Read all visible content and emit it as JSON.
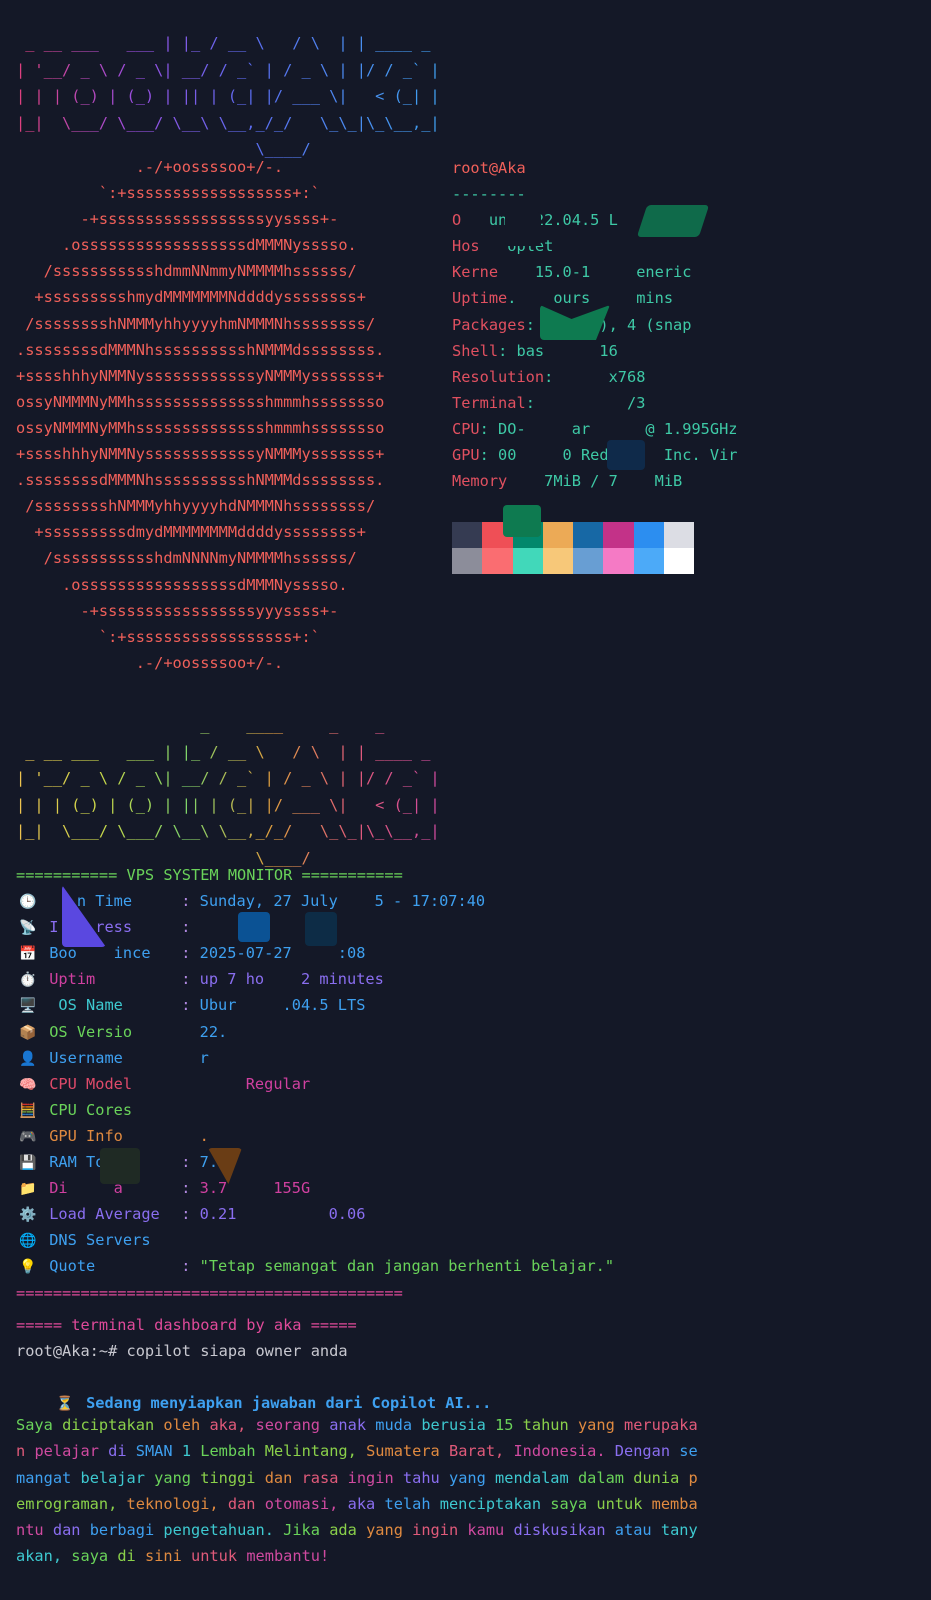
{
  "banner_lines": [
    " _ __ ___   ___ | |_ / __ \\   / \\  | | ____ _",
    "| '__/ _ \\ / _ \\| __/ / _` | / _ \\ | |/ / _` |",
    "| | | (_) | (_) | || | (_| |/ ___ \\|   < (_| |",
    "|_|  \\___/ \\___/ \\__\\ \\__,_/_/   \\_\\_|\\_\\__,_|",
    "                          \\____/"
  ],
  "banner_lines_2": [
    "                    _    ____     _    _",
    " _ __ ___   ___ | |_ / __ \\   / \\  | | ____ _",
    "| '__/ _ \\ / _ \\| __/ / _` | / _ \\ | |/ / _` |",
    "| | | (_) | (_) | || | (_| |/ ___ \\|   < (_| |",
    "|_|  \\___/ \\___/ \\__\\ \\__,_/_/   \\_\\_|\\_\\__,_|",
    "                          \\____/"
  ],
  "ubuntu_logo_lines": [
    "             .-/+oossssoo+/-.",
    "         `:+ssssssssssssssssss+:`",
    "       -+ssssssssssssssssssyyssss+-",
    "     .ossssssssssssssssssdMMMNysssso.",
    "   /ssssssssssshdmmNNmmyNMMMMhssssss/",
    "  +ssssssssshmydMMMMMMMNddddyssssssss+",
    " /sssssssshNMMMyhhyyyyhmNMMMNhssssssss/",
    ".ssssssssdMMMNhsssssssssshNMMMdssssssss.",
    "+sssshhhyNMMNyssssssssssssyNMMMysssssss+",
    "ossyNMMMNyMMhsssssssssssssshmmmhssssssso",
    "ossyNMMMNyMMhsssssssssssssshmmmhssssssso",
    "+sssshhhyNMMNyssssssssssssyNMMMysssssss+",
    ".ssssssssdMMMNhsssssssssshNMMMdssssssss.",
    " /sssssssshNMMMyhhyyyyhdNMMMNhssssssss/",
    "  +sssssssssdmydMMMMMMMMddddyssssssss+",
    "   /ssssssssssshdmNNNNmyNMMMMhssssss/",
    "     .osssssssssssssssssdMMMNysssso.",
    "       -+sssssssssssssssssyyyssss+-",
    "         `:+ssssssssssssssssss+:`",
    "             .-/+oossssoo+/-."
  ],
  "neofetch": {
    "title": "root@Aka",
    "separator": "--------",
    "rows": [
      {
        "key": "O",
        "value": "   untu 22.04.5 L    86_64"
      },
      {
        "key": "Hos",
        "value": "   oplet"
      },
      {
        "key": "Kerne",
        "value": "    15.0-1     eneric"
      },
      {
        "key": "Uptime",
        "value": ".    ours     mins"
      },
      {
        "key": "Packages",
        "value": ":     kg), 4 (snap"
      },
      {
        "key": "Shell",
        "value": ": bas      16"
      },
      {
        "key": "Resolution",
        "value": ":      x768"
      },
      {
        "key": "Terminal",
        "value": ":          /3"
      },
      {
        "key": "CPU",
        "value": ": DO-     ar      @ 1.995GHz"
      },
      {
        "key": "GPU",
        "value": ": 00     0 Red      Inc. Vir"
      },
      {
        "key": "Memory",
        "value": "    7MiB / 7    MiB"
      }
    ],
    "palette_top": [
      "#353b52",
      "#ef4f56",
      "#02886c",
      "#ecaa56",
      "#1768a5",
      "#c33288",
      "#2c8ef0",
      "#dcdde4"
    ],
    "palette_bottom": [
      "#8c8d9a",
      "#fa6d71",
      "#41d8ba",
      "#f7c879",
      "#689ed3",
      "#f57ac5",
      "#4caaf8",
      "#ffffff"
    ]
  },
  "monitor": {
    "title": "=========== VPS SYSTEM MONITOR ===========",
    "rows": [
      {
        "icon": "🕒",
        "label": "   n Time",
        "colon": ": ",
        "value": "Sunday, 27 July    5 - 17:07:40"
      },
      {
        "icon": "📡",
        "label": "I    ress",
        "colon": ": ",
        "value": ""
      },
      {
        "icon": "📅",
        "label": "Boo    ince",
        "colon": ": ",
        "value": "2025-07-27     :08"
      },
      {
        "icon": "⏱️",
        "label": "Uptim",
        "colon": ": ",
        "value": "up 7 ho    2 minutes"
      },
      {
        "icon": "🖥️",
        "label": " OS Name",
        "colon": ": ",
        "value": "Ubur     .04.5 LTS"
      },
      {
        "icon": "📦",
        "label": "OS Versio",
        "colon": "  ",
        "value": "22."
      },
      {
        "icon": "👤",
        "label": "Username",
        "colon": "  ",
        "value": "r"
      },
      {
        "icon": "🧠",
        "label": "CPU Model",
        "colon": "  ",
        "value": "     Regular"
      },
      {
        "icon": "🧮",
        "label": "CPU Cores",
        "colon": "  ",
        "value": ""
      },
      {
        "icon": "🎮",
        "label": "GPU Info",
        "colon": "  ",
        "value": "."
      },
      {
        "icon": "💾",
        "label": "RAM To",
        "colon": ": ",
        "value": "7."
      },
      {
        "icon": "📁",
        "label": "Di     a",
        "colon": ": ",
        "value": "3.7     155G"
      },
      {
        "icon": "⚙️",
        "label": "Load Average",
        "colon": ": ",
        "value": "0.21          0.06"
      },
      {
        "icon": "🌐",
        "label": "DNS Servers",
        "colon": "  ",
        "value": ""
      },
      {
        "icon": "💡",
        "label": "Quote",
        "colon": ": ",
        "value": "\"Tetap semangat dan jangan berhenti belajar.\""
      }
    ],
    "rule": "==========================================",
    "footer": "===== terminal dashboard by aka ====="
  },
  "prompt": "root@Aka:~# copilot siapa owner anda",
  "loading": {
    "icon": "⏳",
    "text": "Sedang menyiapkan jawaban dari Copilot AI..."
  },
  "answer_lines": [
    "Saya diciptakan oleh aka, seorang anak muda berusia 15 tahun yang merupaka",
    "n pelajar di SMAN 1 Lembah Melintang, Sumatera Barat, Indonesia. Dengan se",
    "mangat belajar yang tinggi dan rasa ingin tahu yang mendalam dalam dunia p",
    "emrograman, teknologi, dan otomasi, aka telah menciptakan saya untuk memba",
    "ntu dan berbagi pengetahuan. Jika ada yang ingin kamu diskusikan atau tany",
    "akan, saya di sini untuk membantu!"
  ],
  "colors": {
    "background": "#141827",
    "accent_red": "#e05060",
    "accent_green": "#3ec9a6",
    "accent_blue": "#3ea0f0"
  }
}
